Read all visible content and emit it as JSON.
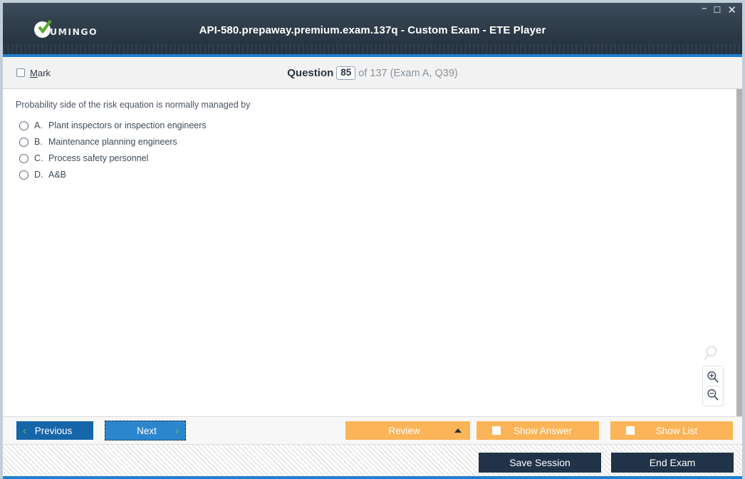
{
  "window": {
    "title": "API-580.prepaway.premium.exam.137q - Custom Exam - ETE Player",
    "logo_text": "UMINGO",
    "controls": {
      "minimize": "–",
      "maximize": "☐",
      "close": "✕"
    }
  },
  "header": {
    "mark_label_accel": "M",
    "mark_label_rest": "ark",
    "question_word": "Question",
    "question_number": "85",
    "question_rest": "of 137 (Exam A, Q39)"
  },
  "question": {
    "text": "Probability side of the risk equation is normally managed by",
    "choices": [
      {
        "letter": "A.",
        "label": "Plant inspectors or inspection engineers",
        "selected": false
      },
      {
        "letter": "B.",
        "label": "Maintenance planning engineers",
        "selected": false
      },
      {
        "letter": "C.",
        "label": "Process safety personnel",
        "selected": false
      },
      {
        "letter": "D.",
        "label": "A&B",
        "selected": false
      }
    ]
  },
  "zoom_tools": {
    "handle_icon": "magnifier-icon",
    "zoom_in_icon": "magnifier-plus-icon",
    "zoom_out_icon": "magnifier-minus-icon"
  },
  "navbar": {
    "previous_label": "Previous",
    "next_label": "Next",
    "previous_chevron": "‹",
    "next_chevron": "›",
    "review_label": "Review",
    "show_answer_label": "Show Answer",
    "show_list_label": "Show List",
    "show_answer_checked": false,
    "show_list_checked": false
  },
  "footer": {
    "save_session_label": "Save Session",
    "end_exam_label": "End Exam"
  },
  "colors": {
    "titlebar_dark": "#233040",
    "titlebar_light": "#3d4c5d",
    "accent_blue": "#1f7fd0",
    "orange": "#fcb458",
    "prev_blue": "#1566a8",
    "next_blue": "#2c86ce",
    "dark_button": "#203348",
    "green_check": "#5aa832",
    "window_border": "#c2ced8"
  }
}
